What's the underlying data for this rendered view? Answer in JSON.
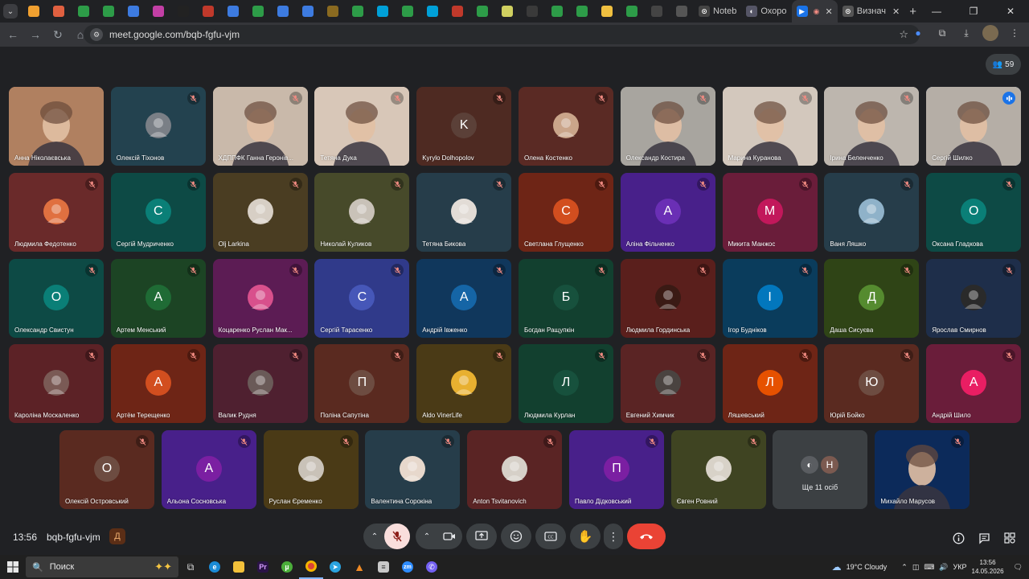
{
  "browser": {
    "tabs": [
      {
        "icon": "notebook-icon",
        "title": "Noteb"
      },
      {
        "icon": "globe-icon",
        "title": "Охоро"
      },
      {
        "icon": "meet-icon",
        "title": "",
        "active": true
      },
      {
        "icon": "docs-icon",
        "title": "Визнач"
      }
    ],
    "url": "meet.google.com/bqb-fgfu-vjm"
  },
  "meet": {
    "participant_count": "59",
    "clock": "13:56",
    "meeting_code": "bqb-fgfu-vjm",
    "more_people": {
      "label": "Ще 11 осіб",
      "initial": "Н"
    },
    "participants": [
      {
        "name": "Анна Ніколаєвська",
        "initial": "",
        "bg": "#b08060",
        "video": true,
        "mic": "none",
        "avbg": ""
      },
      {
        "name": "Олексій Тіхонов",
        "initial": "",
        "bg": "#23424f",
        "video": false,
        "mic": "muted",
        "avbg": "#7a7f86"
      },
      {
        "name": "ХДППФК Ганна Геронів...",
        "initial": "",
        "bg": "#c9b9aa",
        "video": true,
        "mic": "muted",
        "avbg": ""
      },
      {
        "name": "Тетяна Дука",
        "initial": "",
        "bg": "#d8c7b8",
        "video": true,
        "mic": "muted",
        "avbg": ""
      },
      {
        "name": "Kyrylo Dolhopolov",
        "initial": "K",
        "bg": "#4e2a22",
        "video": false,
        "mic": "muted",
        "avbg": "#5b4038"
      },
      {
        "name": "Олена Костенко",
        "initial": "",
        "bg": "#5a2a24",
        "video": false,
        "mic": "muted",
        "avbg": "#caa58a"
      },
      {
        "name": "Олександр Костира",
        "initial": "",
        "bg": "#a8a59f",
        "video": true,
        "mic": "muted",
        "avbg": ""
      },
      {
        "name": "Марина Куранова",
        "initial": "",
        "bg": "#d3c8bd",
        "video": true,
        "mic": "muted",
        "avbg": ""
      },
      {
        "name": "Ірина Беленченко",
        "initial": "",
        "bg": "#bdb6ae",
        "video": true,
        "mic": "muted",
        "avbg": ""
      },
      {
        "name": "Сергій Шилко",
        "initial": "",
        "bg": "#b5aea6",
        "video": true,
        "mic": "active",
        "avbg": ""
      },
      {
        "name": "Людмила Федотенко",
        "initial": "",
        "bg": "#6a2a2a",
        "video": false,
        "mic": "muted",
        "avbg": "#e07040"
      },
      {
        "name": "Сергій Мудриченко",
        "initial": "С",
        "bg": "#0d4a45",
        "video": false,
        "mic": "muted",
        "avbg": "#0a7f77"
      },
      {
        "name": "Olj Larkina",
        "initial": "",
        "bg": "#4a3d22",
        "video": false,
        "mic": "muted",
        "avbg": "#d7cfc5"
      },
      {
        "name": "Николай Куликов",
        "initial": "",
        "bg": "#474a2a",
        "video": false,
        "mic": "muted",
        "avbg": "#c9c2b8"
      },
      {
        "name": "Тетяна Бикова",
        "initial": "",
        "bg": "#263d4a",
        "video": false,
        "mic": "muted",
        "avbg": "#e2dcd6"
      },
      {
        "name": "Светлана Глущенко",
        "initial": "С",
        "bg": "#6e2516",
        "video": false,
        "mic": "muted",
        "avbg": "#d24e1f"
      },
      {
        "name": "Аліна Фільченко",
        "initial": "А",
        "bg": "#48208a",
        "video": false,
        "mic": "muted",
        "avbg": "#6a2fb5"
      },
      {
        "name": "Микита Манжос",
        "initial": "М",
        "bg": "#6a1d3a",
        "video": false,
        "mic": "muted",
        "avbg": "#c2185b"
      },
      {
        "name": "Ваня Ляшко",
        "initial": "",
        "bg": "#263d4a",
        "video": false,
        "mic": "muted",
        "avbg": "#8fb2c9"
      },
      {
        "name": "Оксана Гладкова",
        "initial": "О",
        "bg": "#0d4a45",
        "video": false,
        "mic": "muted",
        "avbg": "#0a7f77"
      },
      {
        "name": "Олександр Свистун",
        "initial": "О",
        "bg": "#0d4a45",
        "video": false,
        "mic": "muted",
        "avbg": "#0a7f77"
      },
      {
        "name": "Артем Менський",
        "initial": "А",
        "bg": "#1c4424",
        "video": false,
        "mic": "muted",
        "avbg": "#1f6b35"
      },
      {
        "name": "Коцаренко Руслан Мак...",
        "initial": "",
        "bg": "#5c1c54",
        "video": false,
        "mic": "muted",
        "avbg": "#d8508c"
      },
      {
        "name": "Сергій Тарасенко",
        "initial": "С",
        "bg": "#303a8a",
        "video": false,
        "mic": "muted",
        "avbg": "#4657b8"
      },
      {
        "name": "Андрій Івженко",
        "initial": "А",
        "bg": "#10375c",
        "video": false,
        "mic": "muted",
        "avbg": "#1565a6"
      },
      {
        "name": "Богдан Ращупкін",
        "initial": "Б",
        "bg": "#12402f",
        "video": false,
        "mic": "muted",
        "avbg": "#17513d"
      },
      {
        "name": "Людмила Гординська",
        "initial": "",
        "bg": "#5a1f1c",
        "video": false,
        "mic": "muted",
        "avbg": "#3a1a14"
      },
      {
        "name": "Ігор Будніков",
        "initial": "І",
        "bg": "#0a3c5c",
        "video": false,
        "mic": "muted",
        "avbg": "#0277bd"
      },
      {
        "name": "Даша Сисуєва",
        "initial": "Д",
        "bg": "#2f4416",
        "video": false,
        "mic": "muted",
        "avbg": "#558b2f"
      },
      {
        "name": "Ярослав Смирнов",
        "initial": "",
        "bg": "#1e2e4a",
        "video": false,
        "mic": "muted",
        "avbg": "#2a2a2a"
      },
      {
        "name": "Кароліна Москаленко",
        "initial": "",
        "bg": "#5c2226",
        "video": false,
        "mic": "muted",
        "avbg": "#7a5a55"
      },
      {
        "name": "Артём Терещенко",
        "initial": "А",
        "bg": "#6e2516",
        "video": false,
        "mic": "muted",
        "avbg": "#d24e1f"
      },
      {
        "name": "Валик Рудня",
        "initial": "",
        "bg": "#4f2030",
        "video": false,
        "mic": "muted",
        "avbg": "#6a5a58"
      },
      {
        "name": "Поліна Сапутіна",
        "initial": "П",
        "bg": "#5a2a20",
        "video": false,
        "mic": "muted",
        "avbg": "#6d4c41"
      },
      {
        "name": "Aldo VinerLife",
        "initial": "",
        "bg": "#4a3a16",
        "video": false,
        "mic": "muted",
        "avbg": "#e8b030"
      },
      {
        "name": "Людмила Курлан",
        "initial": "Л",
        "bg": "#12402f",
        "video": false,
        "mic": "muted",
        "avbg": "#17513d"
      },
      {
        "name": "Евгений Химчик",
        "initial": "",
        "bg": "#5a2424",
        "video": false,
        "mic": "muted",
        "avbg": "#4a4340"
      },
      {
        "name": "Ляшевський",
        "initial": "Л",
        "bg": "#6e2516",
        "video": false,
        "mic": "muted",
        "avbg": "#e65100"
      },
      {
        "name": "Юрій Бойко",
        "initial": "Ю",
        "bg": "#5a2a20",
        "video": false,
        "mic": "muted",
        "avbg": "#6d4c41"
      },
      {
        "name": "Андрій Шило",
        "initial": "А",
        "bg": "#6a1d3a",
        "video": false,
        "mic": "muted",
        "avbg": "#e91e63"
      },
      {
        "name": "Олексій Островський",
        "initial": "О",
        "bg": "#5a2a20",
        "video": false,
        "mic": "muted",
        "avbg": "#6d4c41"
      },
      {
        "name": "Альона Сосновська",
        "initial": "А",
        "bg": "#48208a",
        "video": false,
        "mic": "muted",
        "avbg": "#7b1fa2"
      },
      {
        "name": "Руслан Єременко",
        "initial": "",
        "bg": "#4a3a16",
        "video": false,
        "mic": "muted",
        "avbg": "#c9c2b8"
      },
      {
        "name": "Валентина Сорокіна",
        "initial": "",
        "bg": "#263d4a",
        "video": false,
        "mic": "muted",
        "avbg": "#e7d8cc"
      },
      {
        "name": "Anton Tsvitanovich",
        "initial": "",
        "bg": "#5a2424",
        "video": false,
        "mic": "muted",
        "avbg": "#d6d0c8"
      },
      {
        "name": "Павло Дідковський",
        "initial": "П",
        "bg": "#48208a",
        "video": false,
        "mic": "muted",
        "avbg": "#7b1fa2"
      },
      {
        "name": "Євген Ровний",
        "initial": "",
        "bg": "#3f4422",
        "video": false,
        "mic": "muted",
        "avbg": "#d8d2c8"
      },
      {
        "name": "Михайло Марусов",
        "initial": "",
        "bg": "#0c2a5a",
        "video": true,
        "mic": "muted",
        "avbg": ""
      }
    ]
  },
  "taskbar": {
    "search_label": "Поиск",
    "weather": "19°C  Cloudy",
    "language": "УКР",
    "time": "13:56",
    "date": "14.05.2026"
  },
  "colors": {
    "accent": "#8ab4f8",
    "end_call": "#ea4335",
    "mic_muted_btn": "#f9dedc"
  }
}
